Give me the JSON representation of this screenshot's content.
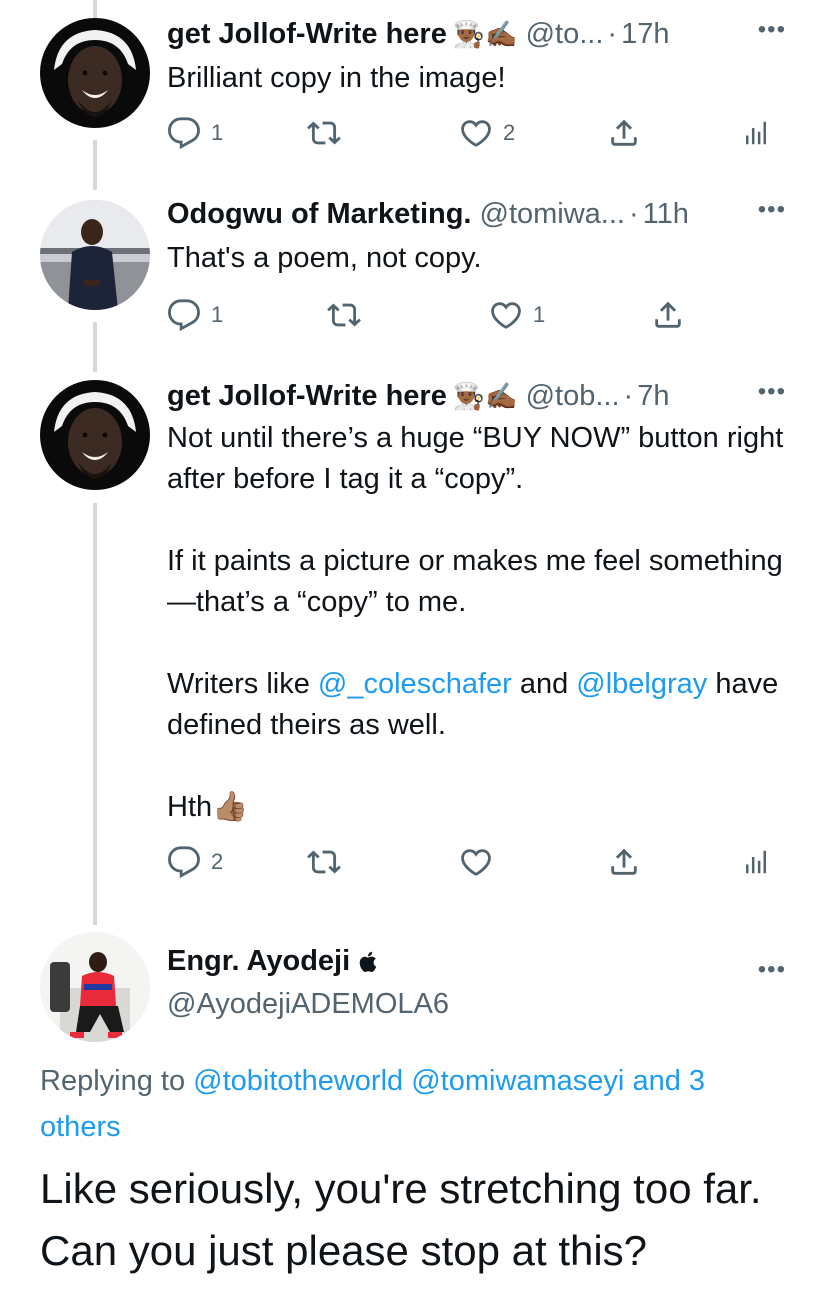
{
  "colors": {
    "accent": "#1d9bf0",
    "muted": "#536471",
    "text": "#0f1419",
    "thread_line": "#cfd9de"
  },
  "tweets": [
    {
      "name": "get Jollof-Write here",
      "emoji": "👨🏾‍🍳✍🏾",
      "handle": "@to...",
      "dot": "·",
      "time": "17h",
      "more": "•••",
      "text": "Brilliant copy in the image!",
      "actions": {
        "reply_count": "1",
        "retweet_count": "",
        "like_count": "2"
      }
    },
    {
      "name": "Odogwu of Marketing.",
      "handle": "@tomiwa...",
      "dot": "·",
      "time": "11h",
      "more": "•••",
      "text": "That's a poem, not copy.",
      "actions": {
        "reply_count": "1",
        "retweet_count": "",
        "like_count": "1"
      }
    },
    {
      "name": "get Jollof-Write here",
      "emoji": "👨🏾‍🍳✍🏾",
      "handle": "@tob...",
      "dot": "·",
      "time": "7h",
      "more": "•••",
      "para1": "Not until there’s a huge “BUY NOW” button right after before I tag it a “copy”.",
      "para2": "If it paints a picture or makes me feel something—that’s a “copy” to me.",
      "para3_prefix": "Writers like ",
      "mention1": "@_coleschafer",
      "para3_mid": " and ",
      "mention2": "@lbelgray",
      "para3_suffix": " have defined theirs as well.",
      "para4": "Hth👍🏽",
      "actions": {
        "reply_count": "2",
        "retweet_count": "",
        "like_count": ""
      }
    }
  ],
  "focus": {
    "name": "Engr. Ayodeji",
    "name_badge": "",
    "handle": "@AyodejiADEMOLA6",
    "more": "•••",
    "replying_prefix": "Replying to ",
    "replying_mention1": "@tobitotheworld",
    "replying_mention2": "@tomiwamaseyi",
    "replying_others": "and 3 others",
    "text": "Like seriously, you're stretching too far. Can you just please stop at this?"
  },
  "icons": [
    "reply-icon",
    "retweet-icon",
    "like-icon",
    "share-icon",
    "analytics-icon",
    "more-icon",
    "apple-icon"
  ]
}
